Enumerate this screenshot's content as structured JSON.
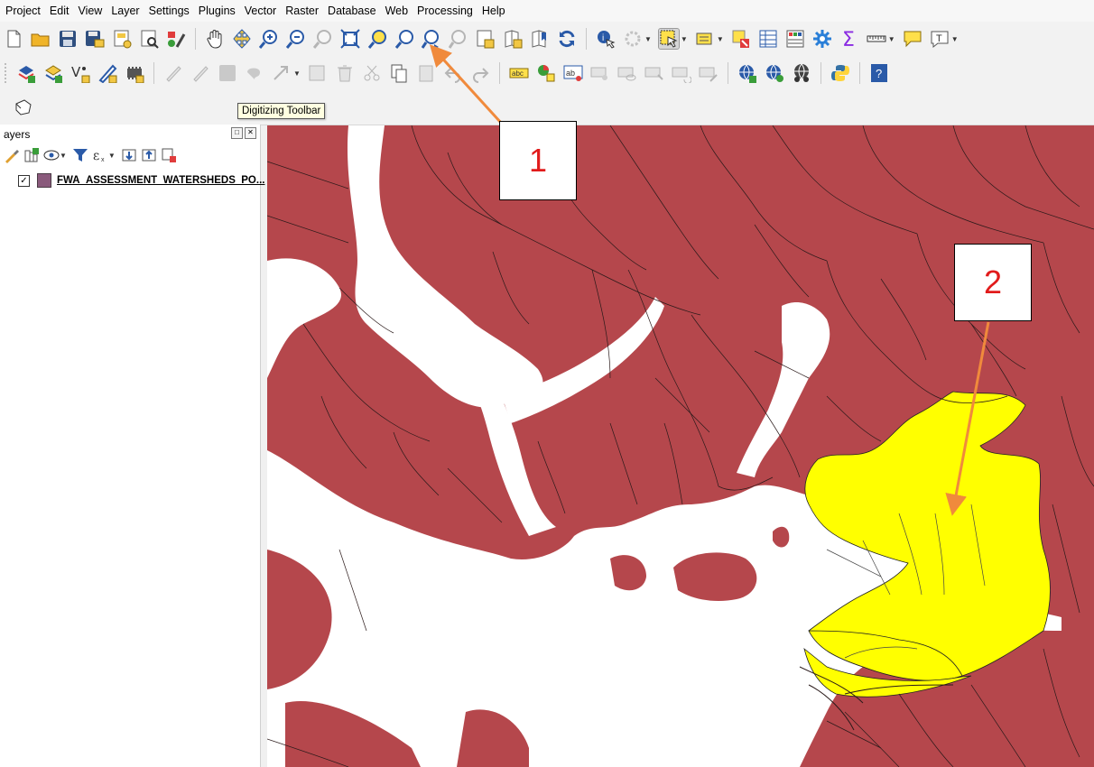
{
  "menu": [
    "Project",
    "Edit",
    "View",
    "Layer",
    "Settings",
    "Plugins",
    "Vector",
    "Raster",
    "Database",
    "Web",
    "Processing",
    "Help"
  ],
  "toolbar": {
    "tooltip": "Digitizing Toolbar",
    "text_tool_label": "T",
    "abc_label": "abc",
    "ab_label": "ab",
    "help_label": "?"
  },
  "layers_panel": {
    "title": "ayers",
    "float_btn": "□",
    "close_btn": "✕",
    "layers": [
      {
        "name": "FWA_ASSESSMENT_WATERSHEDS_PO...",
        "checked": "✓",
        "color": "#8a5a7c"
      }
    ]
  },
  "map": {
    "land_color": "#b5474c",
    "selected_color": "#ffff00",
    "water_color": "#ffffff"
  },
  "annotations": [
    {
      "label": "1"
    },
    {
      "label": "2"
    }
  ],
  "colors": {
    "arrow": "#f08a3c",
    "callout_text": "#e11b1b"
  }
}
